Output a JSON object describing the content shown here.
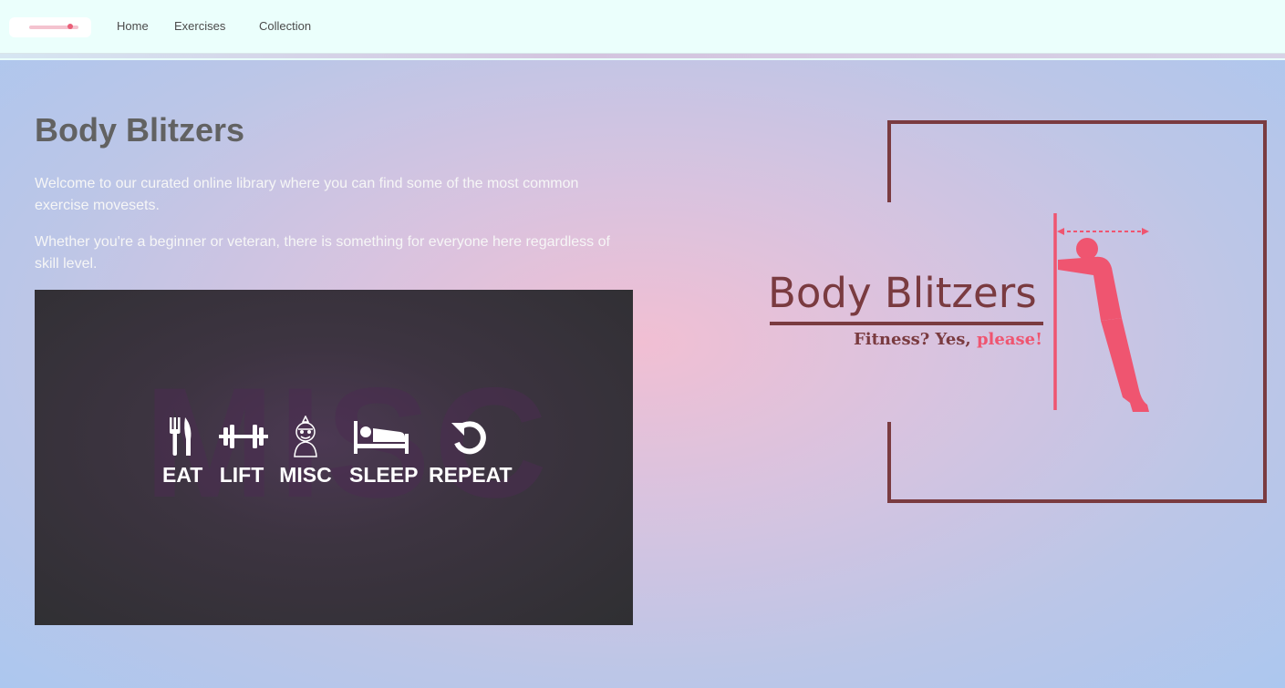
{
  "nav": {
    "home": "Home",
    "exercises": "Exercises",
    "collection": "Collection"
  },
  "hero": {
    "title": "Body Blitzers",
    "paragraphs": [
      "Welcome to our curated online library where you can find some of the most common exercise movesets.",
      "Whether you're a beginner or veteran, there is something for everyone here regardless of skill level."
    ]
  },
  "poster": {
    "background_text": "MISC",
    "items": [
      {
        "label": "EAT",
        "icon": "fork-knife-icon"
      },
      {
        "label": "LIFT",
        "icon": "dumbbell-icon"
      },
      {
        "label": "MISC",
        "icon": "character-icon"
      },
      {
        "label": "SLEEP",
        "icon": "bed-icon"
      },
      {
        "label": "REPEAT",
        "icon": "repeat-icon"
      }
    ]
  },
  "logo": {
    "name": "Body Blitzers",
    "tagline_dark": "Fitness? Yes,",
    "tagline_pink": "please!"
  },
  "colors": {
    "accent_pink": "#ef5570",
    "logo_maroon": "#7a3b40",
    "title_gray": "#626262"
  }
}
